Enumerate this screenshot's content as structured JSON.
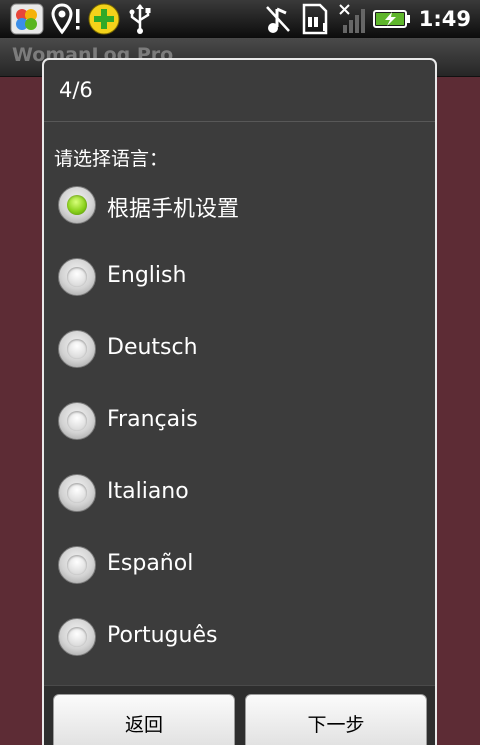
{
  "status_bar": {
    "time": "1:49",
    "icons": [
      "photo-app-icon",
      "location-alert-icon",
      "plus-badge-icon",
      "usb-icon",
      "music-off-icon",
      "sd-card-icon",
      "no-signal-icon",
      "battery-charging-icon"
    ]
  },
  "app": {
    "title": "WomanLog Pro"
  },
  "dialog": {
    "title": "4/6",
    "prompt": "请选择语言：",
    "options": [
      {
        "label": "根据手机设置",
        "selected": true
      },
      {
        "label": "English",
        "selected": false
      },
      {
        "label": "Deutsch",
        "selected": false
      },
      {
        "label": "Français",
        "selected": false
      },
      {
        "label": "Italiano",
        "selected": false
      },
      {
        "label": "Español",
        "selected": false
      },
      {
        "label": "Português",
        "selected": false
      }
    ],
    "buttons": {
      "back": "返回",
      "next": "下一步"
    }
  },
  "colors": {
    "background": "#5d2c35",
    "dialog": "#3c3c3c",
    "radio_selected": "#8bd21c"
  }
}
